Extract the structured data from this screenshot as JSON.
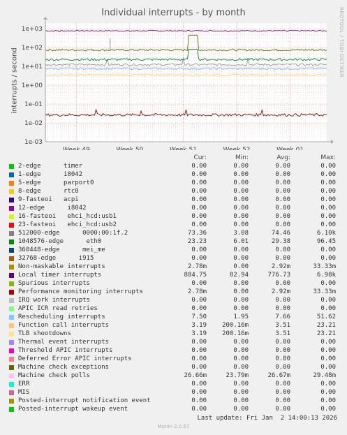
{
  "header": {
    "title": "Individual interrupts - by month",
    "side_note": "RRDTOOL / TOBI OETIKER"
  },
  "chart_data": {
    "type": "line",
    "title": "Individual interrupts - by month",
    "ylabel": "interrupts / second",
    "yscale": "log",
    "ylim": [
      0.001,
      2000
    ],
    "yticks": [
      {
        "value": 1000,
        "label": "1e+03"
      },
      {
        "value": 100,
        "label": "1e+02"
      },
      {
        "value": 10,
        "label": "1e+01"
      },
      {
        "value": 1,
        "label": "1e+00"
      },
      {
        "value": 0.1,
        "label": "1e-01"
      },
      {
        "value": 0.01,
        "label": "1e-02"
      },
      {
        "value": 0.001,
        "label": "1e-03"
      }
    ],
    "xlim": [
      0,
      100
    ],
    "xticks": [
      {
        "pos": 11,
        "label": "Week 49"
      },
      {
        "pos": 30,
        "label": "Week 50"
      },
      {
        "pos": 49,
        "label": "Week 51"
      },
      {
        "pos": 68,
        "label": "Week 52"
      },
      {
        "pos": 87,
        "label": "Week 01"
      }
    ],
    "grid": true,
    "series": [
      {
        "name": "Local timer interrupts",
        "color": "#8a1f8a",
        "level": 776.73,
        "noise": 0.03,
        "spikes": [
          [
            5,
            0.87
          ],
          [
            30,
            0.92
          ],
          [
            49,
            0.95
          ],
          [
            65,
            0.88
          ],
          [
            86,
            0.9
          ]
        ],
        "block": null
      },
      {
        "name": "512000-edge 0000:00:1f.2",
        "color": "#6e7a1a",
        "level": 74.46,
        "noise": 0.05,
        "spikes": [],
        "block": [
          51,
          54,
          6.1
        ]
      },
      {
        "name": "Function call interrupts",
        "color": "#9c9c9c",
        "level": 12.5,
        "noise": 0.05,
        "spikes": [
          [
            22,
            2.1
          ],
          [
            49,
            2.4
          ],
          [
            72,
            2.1
          ]
        ],
        "block": null
      },
      {
        "name": "1048576-edge eth0",
        "color": "#15913a",
        "level": 23.23,
        "noise": 0.06,
        "spikes": [],
        "block": [
          51,
          54,
          3.5
        ]
      },
      {
        "name": "Rescheduling interrupts",
        "color": "#79bff0",
        "level": 7.66,
        "noise": 0.05,
        "spikes": [],
        "block": null
      },
      {
        "name": "TLB shootdowns",
        "color": "#ffd073",
        "level": 3.51,
        "noise": 0.04,
        "spikes": [],
        "block": null
      },
      {
        "name": "Machine check polls",
        "color": "#9b1a0e",
        "level": 0.0267,
        "noise": 0.07,
        "spikes": [
          [
            18,
            1.9
          ],
          [
            34,
            1.6
          ],
          [
            50,
            1.9
          ],
          [
            77,
            1.8
          ]
        ],
        "block": null
      },
      {
        "name": "Spurious interrupts",
        "color": "#22aa22",
        "level": 0.001,
        "noise": 0.0,
        "spikes": [],
        "block": null
      }
    ],
    "spike_line": {
      "pos": 23,
      "top": 300,
      "color": "#999999"
    }
  },
  "legend": {
    "headers": {
      "cur": "Cur:",
      "min": "Min:",
      "avg": "Avg:",
      "max": "Max:"
    },
    "rows": [
      {
        "name": "2-edge      timer",
        "color": "#00cc00",
        "cur": "0.00",
        "min": "0.00",
        "avg": "0.00",
        "max": "0.00"
      },
      {
        "name": "1-edge      i8042",
        "color": "#0066b3",
        "cur": "0.00",
        "min": "0.00",
        "avg": "0.00",
        "max": "0.00"
      },
      {
        "name": "5-edge      parport0",
        "color": "#ff8000",
        "cur": "0.00",
        "min": "0.00",
        "avg": "0.00",
        "max": "0.00"
      },
      {
        "name": "8-edge      rtc0",
        "color": "#ffcc00",
        "cur": "0.00",
        "min": "0.00",
        "avg": "0.00",
        "max": "0.00"
      },
      {
        "name": "9-fasteoi   acpi",
        "color": "#330099",
        "cur": "0.00",
        "min": "0.00",
        "avg": "0.00",
        "max": "0.00"
      },
      {
        "name": "12-edge      i8042",
        "color": "#990099",
        "cur": "0.00",
        "min": "0.00",
        "avg": "0.00",
        "max": "0.00"
      },
      {
        "name": "16-fasteoi   ehci_hcd:usb1",
        "color": "#ccff00",
        "cur": "0.00",
        "min": "0.00",
        "avg": "0.00",
        "max": "0.00"
      },
      {
        "name": "23-fasteoi   ehci_hcd:usb2",
        "color": "#ff0000",
        "cur": "0.00",
        "min": "0.00",
        "avg": "0.00",
        "max": "0.00"
      },
      {
        "name": "512000-edge      0000:00:1f.2",
        "color": "#808080",
        "cur": "73.36",
        "min": "3.08",
        "avg": "74.46",
        "max": "6.10k"
      },
      {
        "name": "1048576-edge      eth0",
        "color": "#008f00",
        "cur": "23.23",
        "min": "6.01",
        "avg": "29.38",
        "max": "96.45"
      },
      {
        "name": "360448-edge      mei_me",
        "color": "#00487d",
        "cur": "0.00",
        "min": "0.00",
        "avg": "0.00",
        "max": "0.00"
      },
      {
        "name": "32768-edge      i915",
        "color": "#b35a00",
        "cur": "0.00",
        "min": "0.00",
        "avg": "0.00",
        "max": "0.00"
      },
      {
        "name": "Non-maskable interrupts",
        "color": "#b38f00",
        "cur": "2.78m",
        "min": "0.00",
        "avg": "2.92m",
        "max": "33.33m"
      },
      {
        "name": "Local timer interrupts",
        "color": "#6b006b",
        "cur": "884.75",
        "min": "82.94",
        "avg": "776.73",
        "max": "6.98k"
      },
      {
        "name": "Spurious interrupts",
        "color": "#8fb300",
        "cur": "0.00",
        "min": "0.00",
        "avg": "0.00",
        "max": "0.00"
      },
      {
        "name": "Performance monitoring interrupts",
        "color": "#b30000",
        "cur": "2.78m",
        "min": "0.00",
        "avg": "2.92m",
        "max": "33.33m"
      },
      {
        "name": "IRQ work interrupts",
        "color": "#bebebe",
        "cur": "0.00",
        "min": "0.00",
        "avg": "0.00",
        "max": "0.00"
      },
      {
        "name": "APIC ICR read retries",
        "color": "#80ff80",
        "cur": "0.00",
        "min": "0.00",
        "avg": "0.00",
        "max": "0.00"
      },
      {
        "name": "Rescheduling interrupts",
        "color": "#80c9ff",
        "cur": "7.50",
        "min": "1.95",
        "avg": "7.66",
        "max": "51.62"
      },
      {
        "name": "Function call interrupts",
        "color": "#ffc080",
        "cur": "3.19",
        "min": "200.16m",
        "avg": "3.51",
        "max": "23.21"
      },
      {
        "name": "TLB shootdowns",
        "color": "#ffe680",
        "cur": "3.19",
        "min": "200.16m",
        "avg": "3.51",
        "max": "23.21"
      },
      {
        "name": "Thermal event interrupts",
        "color": "#aa80ff",
        "cur": "0.00",
        "min": "0.00",
        "avg": "0.00",
        "max": "0.00"
      },
      {
        "name": "Threshold APIC interrupts",
        "color": "#ee00cc",
        "cur": "0.00",
        "min": "0.00",
        "avg": "0.00",
        "max": "0.00"
      },
      {
        "name": "Deferred Error APIC interrupts",
        "color": "#ff8080",
        "cur": "0.00",
        "min": "0.00",
        "avg": "0.00",
        "max": "0.00"
      },
      {
        "name": "Machine check exceptions",
        "color": "#666600",
        "cur": "0.00",
        "min": "0.00",
        "avg": "0.00",
        "max": "0.00"
      },
      {
        "name": "Machine check polls",
        "color": "#ffbfff",
        "cur": "26.66m",
        "min": "23.79m",
        "avg": "26.67m",
        "max": "29.48m"
      },
      {
        "name": "ERR",
        "color": "#00ffcc",
        "cur": "0.00",
        "min": "0.00",
        "avg": "0.00",
        "max": "0.00"
      },
      {
        "name": "MIS",
        "color": "#cc6699",
        "cur": "0.00",
        "min": "0.00",
        "avg": "0.00",
        "max": "0.00"
      },
      {
        "name": "Posted-interrupt notification event",
        "color": "#999900",
        "cur": "0.00",
        "min": "0.00",
        "avg": "0.00",
        "max": "0.00"
      },
      {
        "name": "Posted-interrupt wakeup event",
        "color": "#00cc00",
        "cur": "0.00",
        "min": "0.00",
        "avg": "0.00",
        "max": "0.00"
      }
    ]
  },
  "footer": {
    "last_update": "Last update: Fri Jan  2 14:00:13 2026",
    "version": "Munin 2.0.57"
  }
}
